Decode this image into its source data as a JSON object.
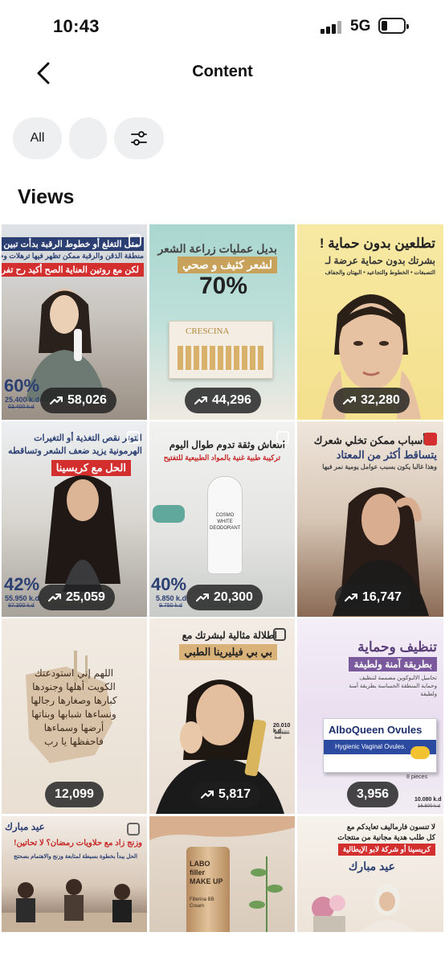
{
  "status_bar": {
    "time": "10:43",
    "network": "5G"
  },
  "nav": {
    "title": "Content"
  },
  "filters": {
    "all_label": "All"
  },
  "section": {
    "title": "Views"
  },
  "tiles": [
    {
      "views": "58,026",
      "banner1": "متى التغلغ أو خطوط الرقبة بدأت تبين أكثر؟",
      "banner2": "منطقة الذقن والرقبة ممكن تظهر فيها ترهلات وخطوط",
      "banner3": "لكن مع روتين العناية الصح أكيد رح تفرق",
      "discount": "60%",
      "price_now": "25.400 k.d",
      "price_old": "63.400 k.d"
    },
    {
      "views": "44,296",
      "headline1": "بديل عمليات زراعة الشعر",
      "headline2": "لشعر كثيف و صحي",
      "discount": "70%",
      "product": "CRESCINA"
    },
    {
      "views": "32,280",
      "headline1": "تطلعين بدون حماية !",
      "headline2": "بشرتك بدون حماية عرضة لـ",
      "headline3": "التصبغات • الخطوط والتجاعيد • البهتان والجفاف"
    },
    {
      "views": "25,059",
      "headline1": "التوتر نقص التغذية أو التغيرات",
      "headline2": "الهرمونية يزيد ضعف الشعر وتساقطه",
      "banner": "الحل مع كريسينا",
      "discount": "42%",
      "price_now": "55.950 k.d",
      "price_old": "97.300 k.d"
    },
    {
      "views": "20,300",
      "headline1": "انتعاش وثقة تدوم طوال اليوم",
      "banner": "تركيبة طبية غنية بالمواد الطبيعية للتفتيح",
      "discount": "40%",
      "price_now": "5.850 k.d",
      "price_old": "9.750 k.d",
      "product": "COSMO WHITE DEODORANT"
    },
    {
      "views": "16,747",
      "headline1": "أسباب ممكن تخلي شعرك",
      "headline2": "يتساقط أكثر من المعتاد",
      "headline3": "وهذا غالبا يكون بسبب عوامل يومية نمر فيها"
    },
    {
      "views": "12,099",
      "text": "اللهم إني استودعتك الكويت أهلها وجنودها كبارها وصغارها رجالها ونساءها شبابها وبناتها أرضها وسماءها فاحفظها يا رب"
    },
    {
      "views": "5,817",
      "headline1": "اطلالة مثالية لبشرتك مع",
      "banner": "بي بي فيليرينا الطبي",
      "price_now": "20.010 k.d",
      "price_old": "28.680 k.d"
    },
    {
      "views": "3,956",
      "headline1": "تنظيف وحماية",
      "banner": "بطريقة آمنة ولطيفة",
      "headline2": "تحاميل الالبوكوين مصممة لتنظيف وحماية المنطقة الحساسة بطريقة آمنة ولطيفة",
      "product": "AlboQueen Ovules",
      "product_sub": "Hygienic Vaginal Ovules.",
      "pieces": "8 pieces",
      "price_now": "10.080 k.d",
      "price_old": "16.800 k.d"
    },
    {
      "views": "",
      "headline1": "عيد مبارك",
      "headline2": "وزنج زاد مع حلاويات رمضان؟ لا تحاتين!",
      "banner": "الحل يبدأ بخطوة بسيطة لمتابعة وزنج والاهتمام بصحتج"
    },
    {
      "views": "",
      "product": "LABO filler MAKE UP",
      "product_sub": "Fillerina BB Cream"
    },
    {
      "views": "",
      "headline1": "لا تنسون فارماليف تعايدكم مع",
      "headline2": "كل طلب هدية مجانية من منتجات",
      "banner": "كريسينا أو شركة لابو الإيطالية",
      "headline3": "عيد مبارك"
    }
  ],
  "colors": {
    "chip_bg": "#eeeff1",
    "pill_bg": "#1e1e20",
    "banner_red": "#d32f2f",
    "banner_navy": "#2b3f73"
  },
  "icons": [
    "back-arrow-icon",
    "filter-sliders-icon",
    "trending-up-icon",
    "signal-icon",
    "battery-icon",
    "reel-icon"
  ]
}
